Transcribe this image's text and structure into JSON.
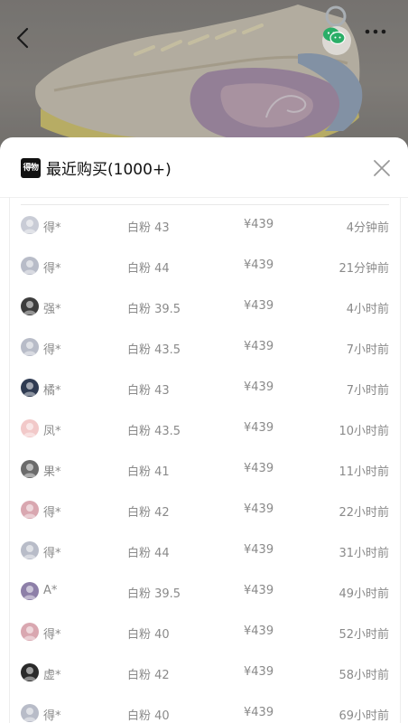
{
  "header": {
    "back_icon": "chevron-left-icon",
    "share_icon": "wechat-icon",
    "more_icon": "more-horizontal-icon"
  },
  "sheet": {
    "brand_logo_text": "得物",
    "title": "最近购买(1000+)",
    "close_icon": "close-icon"
  },
  "purchases": [
    {
      "user": "得*",
      "spec": "白粉 43",
      "price": "¥439",
      "time": "4分钟前",
      "avatar_color": "#c9ccd6"
    },
    {
      "user": "得*",
      "spec": "白粉 44",
      "price": "¥439",
      "time": "21分钟前",
      "avatar_color": "#b8bcc8"
    },
    {
      "user": "强*",
      "spec": "白粉 39.5",
      "price": "¥439",
      "time": "4小时前",
      "avatar_color": "#3d3d3d"
    },
    {
      "user": "得*",
      "spec": "白粉 43.5",
      "price": "¥439",
      "time": "7小时前",
      "avatar_color": "#b8bcc8"
    },
    {
      "user": "橘*",
      "spec": "白粉 43",
      "price": "¥439",
      "time": "7小时前",
      "avatar_color": "#2f3b52"
    },
    {
      "user": "凤*",
      "spec": "白粉 43.5",
      "price": "¥439",
      "time": "10小时前",
      "avatar_color": "#f2c9c9"
    },
    {
      "user": "果*",
      "spec": "白粉 41",
      "price": "¥439",
      "time": "11小时前",
      "avatar_color": "#6b6b6b"
    },
    {
      "user": "得*",
      "spec": "白粉 42",
      "price": "¥439",
      "time": "22小时前",
      "avatar_color": "#d9a7b0"
    },
    {
      "user": "得*",
      "spec": "白粉 44",
      "price": "¥439",
      "time": "31小时前",
      "avatar_color": "#b8bcc8"
    },
    {
      "user": "A*",
      "spec": "白粉 39.5",
      "price": "¥439",
      "time": "49小时前",
      "avatar_color": "#8d7fa8"
    },
    {
      "user": "得*",
      "spec": "白粉 40",
      "price": "¥439",
      "time": "52小时前",
      "avatar_color": "#d9a7b0"
    },
    {
      "user": "虚*",
      "spec": "白粉 42",
      "price": "¥439",
      "time": "58小时前",
      "avatar_color": "#2a2a2a"
    },
    {
      "user": "得*",
      "spec": "白粉 40",
      "price": "¥439",
      "time": "69小时前",
      "avatar_color": "#b8bcc8"
    }
  ]
}
